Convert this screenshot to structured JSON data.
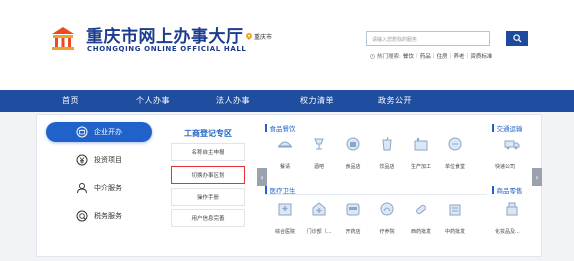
{
  "header": {
    "title": "重庆市网上办事大厅",
    "subtitle": "CHONGQING ONLINE OFFICIAL HALL",
    "location": "重庆市",
    "search_placeholder": "请输入您想找的服务",
    "hot_label": "热门搜索:",
    "hot_items": [
      "餐饮",
      "药品",
      "住房",
      "养老",
      "资质标准"
    ]
  },
  "nav": {
    "items": [
      "首页",
      "个人办事",
      "法人办事",
      "权力清单",
      "政务公开"
    ]
  },
  "left_menu": {
    "items": [
      "企业开办",
      "投资项目",
      "中介服务",
      "税务服务"
    ],
    "active_index": 0
  },
  "mid": {
    "title": "工商登记专区",
    "buttons": [
      "名称自主申报",
      "切换办事区划",
      "操作手册",
      "用户信息完善"
    ],
    "highlighted_index": 1
  },
  "sections": {
    "food": {
      "title": "食品餐饮",
      "labels": [
        "餐请",
        "酒吧",
        "食品店",
        "饮品店",
        "生产加工",
        "单位食堂"
      ]
    },
    "medical": {
      "title": "医疗卫生",
      "labels": [
        "综合医院",
        "门诊部（...",
        "开药店",
        "疗养院",
        "西药批发",
        "中药批发"
      ]
    },
    "traffic": {
      "title": "交通运输",
      "labels": [
        "快递公司"
      ]
    },
    "goods": {
      "title": "商品零售",
      "labels": [
        "化妆品及..."
      ]
    }
  },
  "colors": {
    "brand_blue": "#1f4d9f",
    "accent_blue": "#2062c9",
    "highlight_red": "#e0333a"
  }
}
